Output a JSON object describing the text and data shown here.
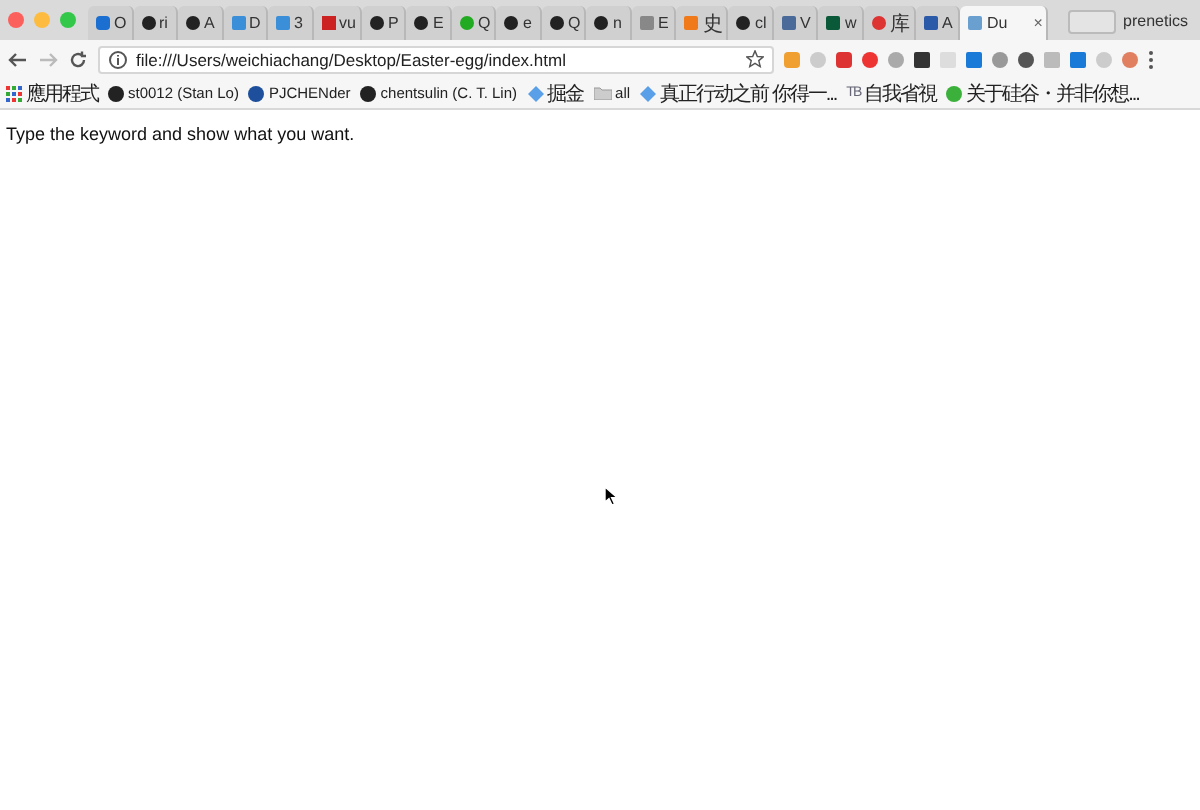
{
  "tabs": [
    {
      "label": "O",
      "selected": false
    },
    {
      "label": "ri",
      "selected": false
    },
    {
      "label": "A",
      "selected": false
    },
    {
      "label": "D",
      "selected": false
    },
    {
      "label": "3",
      "selected": false
    },
    {
      "label": "vu",
      "selected": false
    },
    {
      "label": "P",
      "selected": false
    },
    {
      "label": "E",
      "selected": false
    },
    {
      "label": "Q",
      "selected": false
    },
    {
      "label": "e",
      "selected": false
    },
    {
      "label": "Q",
      "selected": false
    },
    {
      "label": "n",
      "selected": false
    },
    {
      "label": "E",
      "selected": false
    },
    {
      "label": "史",
      "selected": false
    },
    {
      "label": "cl",
      "selected": false
    },
    {
      "label": "V",
      "selected": false
    },
    {
      "label": "w",
      "selected": false
    },
    {
      "label": "库",
      "selected": false
    },
    {
      "label": "A",
      "selected": false
    },
    {
      "label": "Du",
      "selected": true,
      "close": "×"
    }
  ],
  "profile": "prenetics",
  "address": "file:///Users/weichiachang/Desktop/Easter-egg/index.html",
  "bookmarks": [
    {
      "label": "應用程式",
      "kind": "apps"
    },
    {
      "label": "st0012 (Stan Lo)",
      "kind": "github"
    },
    {
      "label": "PJCHENder",
      "kind": "site"
    },
    {
      "label": "chentsulin (C. T. Lin)",
      "kind": "github"
    },
    {
      "label": "掘金",
      "kind": "juejin"
    },
    {
      "label": "all",
      "kind": "folder"
    },
    {
      "label": "真正行动之前 你得一...",
      "kind": "juejin"
    },
    {
      "label": "自我省視",
      "kind": "text",
      "icon_text": "TB"
    },
    {
      "label": "关于硅谷・并非你想...",
      "kind": "wechat"
    }
  ],
  "page_text": "Type the keyword and show what you want."
}
